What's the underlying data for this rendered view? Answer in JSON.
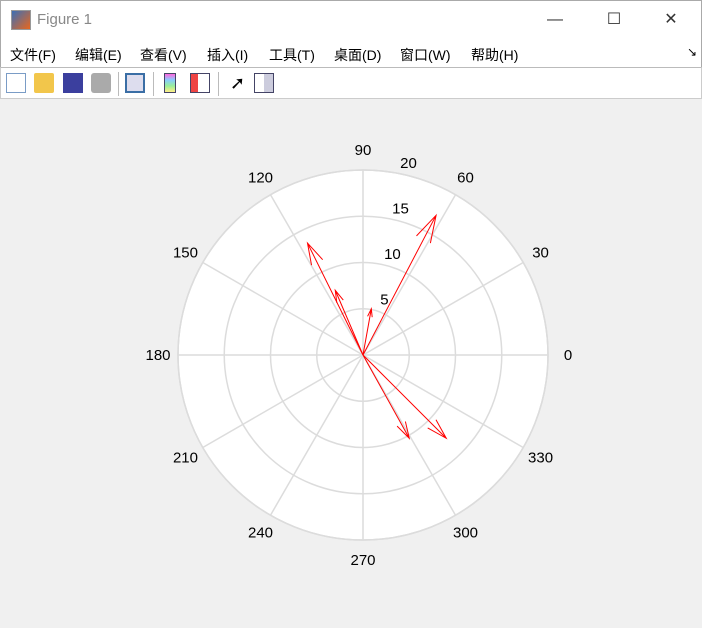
{
  "window": {
    "title": "Figure 1",
    "minimize": "—",
    "maximize": "☐",
    "close": "✕"
  },
  "menu": [
    {
      "label": "文件(F)"
    },
    {
      "label": "编辑(E)"
    },
    {
      "label": "查看(V)"
    },
    {
      "label": "插入(I)"
    },
    {
      "label": "工具(T)"
    },
    {
      "label": "桌面(D)"
    },
    {
      "label": "窗口(W)"
    },
    {
      "label": "帮助(H)"
    }
  ],
  "menu_dock_icon": "↘",
  "toolbar": [
    "new-figure-icon",
    "open-file-icon",
    "save-icon",
    "print-icon",
    "link-plot-icon",
    "colorbar-icon",
    "legend-icon",
    "pointer-icon",
    "property-inspector-icon"
  ],
  "chart_data": {
    "type": "compass",
    "angle_ticks": [
      "0",
      "30",
      "60",
      "90",
      "120",
      "150",
      "180",
      "210",
      "240",
      "270",
      "300",
      "330"
    ],
    "radial_ticks": [
      "5",
      "10",
      "15",
      "20"
    ],
    "rlim": [
      0,
      20
    ],
    "arrow_color": "#ff0000",
    "vectors": [
      {
        "u": 7.9,
        "v": 15.1
      },
      {
        "u": -6.0,
        "v": 12.1
      },
      {
        "u": -3.0,
        "v": 7.0
      },
      {
        "u": 0.9,
        "v": 5.0
      },
      {
        "u": 5.0,
        "v": -9.0
      },
      {
        "u": 9.0,
        "v": -9.0
      }
    ]
  }
}
